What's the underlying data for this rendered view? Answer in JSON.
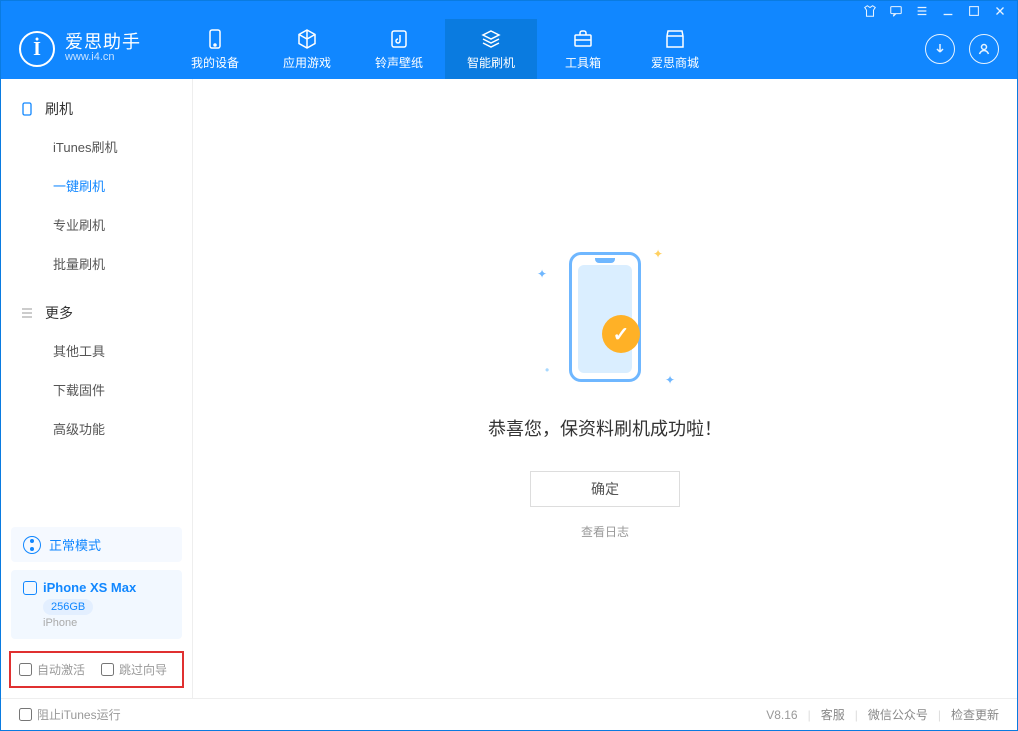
{
  "app": {
    "name": "爱思助手",
    "url": "www.i4.cn"
  },
  "nav": {
    "items": [
      {
        "label": "我的设备",
        "icon": "device"
      },
      {
        "label": "应用游戏",
        "icon": "cube"
      },
      {
        "label": "铃声壁纸",
        "icon": "music"
      },
      {
        "label": "智能刷机",
        "icon": "gear",
        "active": true
      },
      {
        "label": "工具箱",
        "icon": "toolbox"
      },
      {
        "label": "爱思商城",
        "icon": "store"
      }
    ]
  },
  "sidebar": {
    "section1": {
      "title": "刷机",
      "items": [
        "iTunes刷机",
        "一键刷机",
        "专业刷机",
        "批量刷机"
      ]
    },
    "section2": {
      "title": "更多",
      "items": [
        "其他工具",
        "下载固件",
        "高级功能"
      ]
    },
    "mode_label": "正常模式",
    "device": {
      "name": "iPhone XS Max",
      "storage": "256GB",
      "type": "iPhone"
    },
    "options": {
      "auto_activate": "自动激活",
      "skip_guide": "跳过向导"
    }
  },
  "main": {
    "success_msg": "恭喜您，保资料刷机成功啦！",
    "ok_btn": "确定",
    "view_log": "查看日志"
  },
  "statusbar": {
    "block_itunes": "阻止iTunes运行",
    "version": "V8.16",
    "customer_service": "客服",
    "wechat": "微信公众号",
    "check_update": "检查更新"
  }
}
